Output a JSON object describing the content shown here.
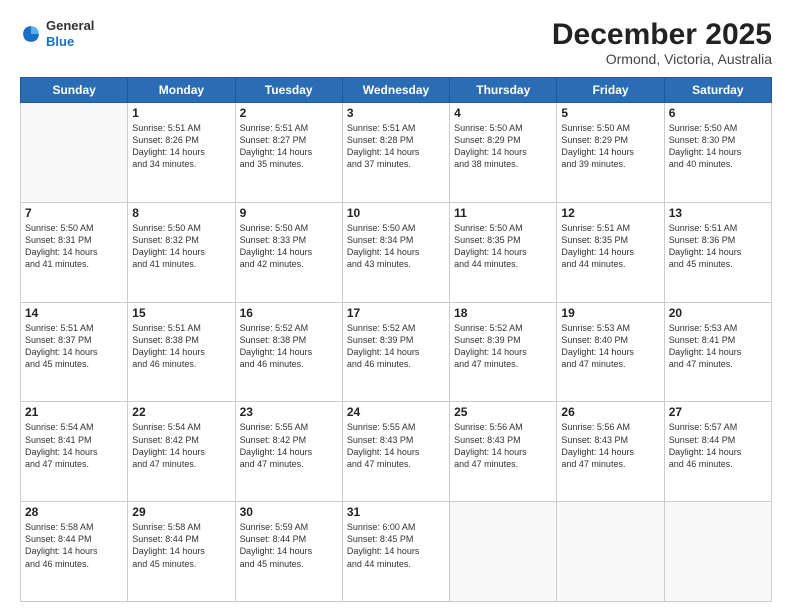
{
  "logo": {
    "general": "General",
    "blue": "Blue"
  },
  "header": {
    "title": "December 2025",
    "subtitle": "Ormond, Victoria, Australia"
  },
  "days": [
    "Sunday",
    "Monday",
    "Tuesday",
    "Wednesday",
    "Thursday",
    "Friday",
    "Saturday"
  ],
  "weeks": [
    [
      {
        "num": "",
        "text": ""
      },
      {
        "num": "1",
        "text": "Sunrise: 5:51 AM\nSunset: 8:26 PM\nDaylight: 14 hours\nand 34 minutes."
      },
      {
        "num": "2",
        "text": "Sunrise: 5:51 AM\nSunset: 8:27 PM\nDaylight: 14 hours\nand 35 minutes."
      },
      {
        "num": "3",
        "text": "Sunrise: 5:51 AM\nSunset: 8:28 PM\nDaylight: 14 hours\nand 37 minutes."
      },
      {
        "num": "4",
        "text": "Sunrise: 5:50 AM\nSunset: 8:29 PM\nDaylight: 14 hours\nand 38 minutes."
      },
      {
        "num": "5",
        "text": "Sunrise: 5:50 AM\nSunset: 8:29 PM\nDaylight: 14 hours\nand 39 minutes."
      },
      {
        "num": "6",
        "text": "Sunrise: 5:50 AM\nSunset: 8:30 PM\nDaylight: 14 hours\nand 40 minutes."
      }
    ],
    [
      {
        "num": "7",
        "text": "Sunrise: 5:50 AM\nSunset: 8:31 PM\nDaylight: 14 hours\nand 41 minutes."
      },
      {
        "num": "8",
        "text": "Sunrise: 5:50 AM\nSunset: 8:32 PM\nDaylight: 14 hours\nand 41 minutes."
      },
      {
        "num": "9",
        "text": "Sunrise: 5:50 AM\nSunset: 8:33 PM\nDaylight: 14 hours\nand 42 minutes."
      },
      {
        "num": "10",
        "text": "Sunrise: 5:50 AM\nSunset: 8:34 PM\nDaylight: 14 hours\nand 43 minutes."
      },
      {
        "num": "11",
        "text": "Sunrise: 5:50 AM\nSunset: 8:35 PM\nDaylight: 14 hours\nand 44 minutes."
      },
      {
        "num": "12",
        "text": "Sunrise: 5:51 AM\nSunset: 8:35 PM\nDaylight: 14 hours\nand 44 minutes."
      },
      {
        "num": "13",
        "text": "Sunrise: 5:51 AM\nSunset: 8:36 PM\nDaylight: 14 hours\nand 45 minutes."
      }
    ],
    [
      {
        "num": "14",
        "text": "Sunrise: 5:51 AM\nSunset: 8:37 PM\nDaylight: 14 hours\nand 45 minutes."
      },
      {
        "num": "15",
        "text": "Sunrise: 5:51 AM\nSunset: 8:38 PM\nDaylight: 14 hours\nand 46 minutes."
      },
      {
        "num": "16",
        "text": "Sunrise: 5:52 AM\nSunset: 8:38 PM\nDaylight: 14 hours\nand 46 minutes."
      },
      {
        "num": "17",
        "text": "Sunrise: 5:52 AM\nSunset: 8:39 PM\nDaylight: 14 hours\nand 46 minutes."
      },
      {
        "num": "18",
        "text": "Sunrise: 5:52 AM\nSunset: 8:39 PM\nDaylight: 14 hours\nand 47 minutes."
      },
      {
        "num": "19",
        "text": "Sunrise: 5:53 AM\nSunset: 8:40 PM\nDaylight: 14 hours\nand 47 minutes."
      },
      {
        "num": "20",
        "text": "Sunrise: 5:53 AM\nSunset: 8:41 PM\nDaylight: 14 hours\nand 47 minutes."
      }
    ],
    [
      {
        "num": "21",
        "text": "Sunrise: 5:54 AM\nSunset: 8:41 PM\nDaylight: 14 hours\nand 47 minutes."
      },
      {
        "num": "22",
        "text": "Sunrise: 5:54 AM\nSunset: 8:42 PM\nDaylight: 14 hours\nand 47 minutes."
      },
      {
        "num": "23",
        "text": "Sunrise: 5:55 AM\nSunset: 8:42 PM\nDaylight: 14 hours\nand 47 minutes."
      },
      {
        "num": "24",
        "text": "Sunrise: 5:55 AM\nSunset: 8:43 PM\nDaylight: 14 hours\nand 47 minutes."
      },
      {
        "num": "25",
        "text": "Sunrise: 5:56 AM\nSunset: 8:43 PM\nDaylight: 14 hours\nand 47 minutes."
      },
      {
        "num": "26",
        "text": "Sunrise: 5:56 AM\nSunset: 8:43 PM\nDaylight: 14 hours\nand 47 minutes."
      },
      {
        "num": "27",
        "text": "Sunrise: 5:57 AM\nSunset: 8:44 PM\nDaylight: 14 hours\nand 46 minutes."
      }
    ],
    [
      {
        "num": "28",
        "text": "Sunrise: 5:58 AM\nSunset: 8:44 PM\nDaylight: 14 hours\nand 46 minutes."
      },
      {
        "num": "29",
        "text": "Sunrise: 5:58 AM\nSunset: 8:44 PM\nDaylight: 14 hours\nand 45 minutes."
      },
      {
        "num": "30",
        "text": "Sunrise: 5:59 AM\nSunset: 8:44 PM\nDaylight: 14 hours\nand 45 minutes."
      },
      {
        "num": "31",
        "text": "Sunrise: 6:00 AM\nSunset: 8:45 PM\nDaylight: 14 hours\nand 44 minutes."
      },
      {
        "num": "",
        "text": ""
      },
      {
        "num": "",
        "text": ""
      },
      {
        "num": "",
        "text": ""
      }
    ]
  ]
}
